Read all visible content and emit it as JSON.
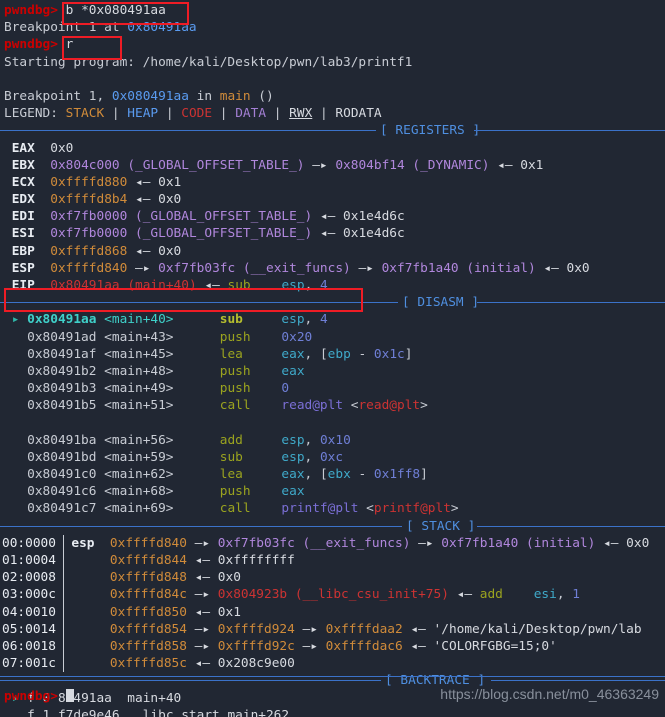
{
  "terminal": {
    "prompt": "pwndbg>",
    "watermark": "https://blog.csdn.net/m0_46363249"
  },
  "session": {
    "cmd1": "b *0x080491aa",
    "out1_a": "Breakpoint 1 at ",
    "out1_b": "0x80491aa",
    "cmd2": "r",
    "out2": "Starting program: /home/kali/Desktop/pwn/lab3/printf1",
    "bp_a": "Breakpoint 1, ",
    "bp_b": "0x080491aa",
    "bp_c": " in ",
    "bp_d": "main",
    "bp_e": " ()",
    "legend_label": "LEGEND: ",
    "legend": {
      "stack": "STACK",
      "heap": "HEAP",
      "code": "CODE",
      "data": "DATA",
      "rwx": "RWX",
      "rodata": "RODATA",
      "sep": " | "
    }
  },
  "sections": {
    "registers": "[ REGISTERS ]",
    "disasm": "[ DISASM ]",
    "stack": "[ STACK ]",
    "backtrace": "[ BACKTRACE ]"
  },
  "registers": [
    {
      "name": "EAX",
      "parts": [
        {
          "t": "0x0",
          "c": "c-num"
        }
      ]
    },
    {
      "name": "EBX",
      "parts": [
        {
          "t": "0x804c000",
          "c": "c-sym"
        },
        {
          "t": " (_GLOBAL_OFFSET_TABLE_)",
          "c": "c-sym"
        },
        {
          "t": " —▸ ",
          "c": "c-arrow"
        },
        {
          "t": "0x804bf14",
          "c": "c-sym"
        },
        {
          "t": " (_DYNAMIC)",
          "c": "c-sym"
        },
        {
          "t": " ◂— ",
          "c": "c-arrow"
        },
        {
          "t": "0x1",
          "c": "c-num"
        }
      ]
    },
    {
      "name": "ECX",
      "parts": [
        {
          "t": "0xffffd880",
          "c": "c-stack"
        },
        {
          "t": " ◂— ",
          "c": "c-arrow"
        },
        {
          "t": "0x1",
          "c": "c-num"
        }
      ]
    },
    {
      "name": "EDX",
      "parts": [
        {
          "t": "0xffffd8b4",
          "c": "c-stack"
        },
        {
          "t": " ◂— ",
          "c": "c-arrow"
        },
        {
          "t": "0x0",
          "c": "c-num"
        }
      ]
    },
    {
      "name": "EDI",
      "parts": [
        {
          "t": "0xf7fb0000",
          "c": "c-sym"
        },
        {
          "t": " (_GLOBAL_OFFSET_TABLE_)",
          "c": "c-sym"
        },
        {
          "t": " ◂— ",
          "c": "c-arrow"
        },
        {
          "t": "0x1e4d6c",
          "c": "c-num"
        }
      ]
    },
    {
      "name": "ESI",
      "parts": [
        {
          "t": "0xf7fb0000",
          "c": "c-sym"
        },
        {
          "t": " (_GLOBAL_OFFSET_TABLE_)",
          "c": "c-sym"
        },
        {
          "t": " ◂— ",
          "c": "c-arrow"
        },
        {
          "t": "0x1e4d6c",
          "c": "c-num"
        }
      ]
    },
    {
      "name": "EBP",
      "parts": [
        {
          "t": "0xffffd868",
          "c": "c-stack"
        },
        {
          "t": " ◂— ",
          "c": "c-arrow"
        },
        {
          "t": "0x0",
          "c": "c-num"
        }
      ]
    },
    {
      "name": "ESP",
      "parts": [
        {
          "t": "0xffffd840",
          "c": "c-stack"
        },
        {
          "t": " —▸ ",
          "c": "c-arrow"
        },
        {
          "t": "0xf7fb03fc",
          "c": "c-sym"
        },
        {
          "t": " (__exit_funcs)",
          "c": "c-sym"
        },
        {
          "t": " —▸ ",
          "c": "c-arrow"
        },
        {
          "t": "0xf7fb1a40",
          "c": "c-sym"
        },
        {
          "t": " (initial)",
          "c": "c-sym"
        },
        {
          "t": " ◂— ",
          "c": "c-arrow"
        },
        {
          "t": "0x0",
          "c": "c-num"
        }
      ]
    },
    {
      "name": "EIP",
      "parts": [
        {
          "t": "0x80491aa",
          "c": "c-eip"
        },
        {
          "t": " (main+40)",
          "c": "c-eip"
        },
        {
          "t": " ◂— ",
          "c": "c-arrow"
        },
        {
          "t": "sub",
          "c": "c-mn"
        },
        {
          "t": "    ",
          "c": "c-plain"
        },
        {
          "t": "esp",
          "c": "c-op"
        },
        {
          "t": ", ",
          "c": "c-plain"
        },
        {
          "t": "4",
          "c": "c-imm"
        }
      ]
    }
  ],
  "disasm": [
    {
      "marker": "▸",
      "current": true,
      "addr": "0x80491aa",
      "sym": "<main+40>",
      "mn": "sub",
      "ops": [
        {
          "t": "esp",
          "c": "c-op"
        },
        {
          "t": ", ",
          "c": "c-plain"
        },
        {
          "t": "4",
          "c": "c-imm"
        }
      ]
    },
    {
      "marker": " ",
      "current": false,
      "addr": "0x80491ad",
      "sym": "<main+43>",
      "mn": "push",
      "ops": [
        {
          "t": "0x20",
          "c": "c-imm"
        }
      ]
    },
    {
      "marker": " ",
      "current": false,
      "addr": "0x80491af",
      "sym": "<main+45>",
      "mn": "lea",
      "ops": [
        {
          "t": "eax",
          "c": "c-op"
        },
        {
          "t": ", [",
          "c": "c-plain"
        },
        {
          "t": "ebp",
          "c": "c-op"
        },
        {
          "t": " - ",
          "c": "c-plain"
        },
        {
          "t": "0x1c",
          "c": "c-imm"
        },
        {
          "t": "]",
          "c": "c-plain"
        }
      ]
    },
    {
      "marker": " ",
      "current": false,
      "addr": "0x80491b2",
      "sym": "<main+48>",
      "mn": "push",
      "ops": [
        {
          "t": "eax",
          "c": "c-op"
        }
      ]
    },
    {
      "marker": " ",
      "current": false,
      "addr": "0x80491b3",
      "sym": "<main+49>",
      "mn": "push",
      "ops": [
        {
          "t": "0",
          "c": "c-imm"
        }
      ]
    },
    {
      "marker": " ",
      "current": false,
      "addr": "0x80491b5",
      "sym": "<main+51>",
      "mn": "call",
      "ops": [
        {
          "t": "read@plt",
          "c": "c-call-t"
        },
        {
          "t": " <",
          "c": "c-plain"
        },
        {
          "t": "read@plt",
          "c": "c-callsym"
        },
        {
          "t": ">",
          "c": "c-plain"
        }
      ]
    },
    {
      "blank": true
    },
    {
      "marker": " ",
      "current": false,
      "addr": "0x80491ba",
      "sym": "<main+56>",
      "mn": "add",
      "ops": [
        {
          "t": "esp",
          "c": "c-op"
        },
        {
          "t": ", ",
          "c": "c-plain"
        },
        {
          "t": "0x10",
          "c": "c-imm"
        }
      ]
    },
    {
      "marker": " ",
      "current": false,
      "addr": "0x80491bd",
      "sym": "<main+59>",
      "mn": "sub",
      "ops": [
        {
          "t": "esp",
          "c": "c-op"
        },
        {
          "t": ", ",
          "c": "c-plain"
        },
        {
          "t": "0xc",
          "c": "c-imm"
        }
      ]
    },
    {
      "marker": " ",
      "current": false,
      "addr": "0x80491c0",
      "sym": "<main+62>",
      "mn": "lea",
      "ops": [
        {
          "t": "eax",
          "c": "c-op"
        },
        {
          "t": ", [",
          "c": "c-plain"
        },
        {
          "t": "ebx",
          "c": "c-op"
        },
        {
          "t": " - ",
          "c": "c-plain"
        },
        {
          "t": "0x1ff8",
          "c": "c-imm"
        },
        {
          "t": "]",
          "c": "c-plain"
        }
      ]
    },
    {
      "marker": " ",
      "current": false,
      "addr": "0x80491c6",
      "sym": "<main+68>",
      "mn": "push",
      "ops": [
        {
          "t": "eax",
          "c": "c-op"
        }
      ]
    },
    {
      "marker": " ",
      "current": false,
      "addr": "0x80491c7",
      "sym": "<main+69>",
      "mn": "call",
      "ops": [
        {
          "t": "printf@plt",
          "c": "c-call-t"
        },
        {
          "t": " <",
          "c": "c-plain"
        },
        {
          "t": "printf@plt",
          "c": "c-callsym"
        },
        {
          "t": ">",
          "c": "c-plain"
        }
      ]
    }
  ],
  "stack": [
    {
      "idx": "00:0000",
      "reg": "esp",
      "parts": [
        {
          "t": "0xffffd840",
          "c": "c-stack"
        },
        {
          "t": " —▸ ",
          "c": "c-arrow"
        },
        {
          "t": "0xf7fb03fc",
          "c": "c-sym"
        },
        {
          "t": " (__exit_funcs)",
          "c": "c-sym"
        },
        {
          "t": " —▸ ",
          "c": "c-arrow"
        },
        {
          "t": "0xf7fb1a40",
          "c": "c-sym"
        },
        {
          "t": " (initial)",
          "c": "c-sym"
        },
        {
          "t": " ◂— ",
          "c": "c-arrow"
        },
        {
          "t": "0x0",
          "c": "c-num"
        }
      ]
    },
    {
      "idx": "01:0004",
      "reg": "",
      "parts": [
        {
          "t": "0xffffd844",
          "c": "c-stack"
        },
        {
          "t": " ◂— ",
          "c": "c-arrow"
        },
        {
          "t": "0xffffffff",
          "c": "c-num"
        }
      ]
    },
    {
      "idx": "02:0008",
      "reg": "",
      "parts": [
        {
          "t": "0xffffd848",
          "c": "c-stack"
        },
        {
          "t": " ◂— ",
          "c": "c-arrow"
        },
        {
          "t": "0x0",
          "c": "c-num"
        }
      ]
    },
    {
      "idx": "03:000c",
      "reg": "",
      "parts": [
        {
          "t": "0xffffd84c",
          "c": "c-stack"
        },
        {
          "t": " —▸ ",
          "c": "c-arrow"
        },
        {
          "t": "0x804923b",
          "c": "c-code"
        },
        {
          "t": " (__libc_csu_init+75)",
          "c": "c-code"
        },
        {
          "t": " ◂— ",
          "c": "c-arrow"
        },
        {
          "t": "add",
          "c": "c-mn"
        },
        {
          "t": "    ",
          "c": "c-plain"
        },
        {
          "t": "esi",
          "c": "c-op"
        },
        {
          "t": ", ",
          "c": "c-plain"
        },
        {
          "t": "1",
          "c": "c-imm"
        }
      ]
    },
    {
      "idx": "04:0010",
      "reg": "",
      "parts": [
        {
          "t": "0xffffd850",
          "c": "c-stack"
        },
        {
          "t": " ◂— ",
          "c": "c-arrow"
        },
        {
          "t": "0x1",
          "c": "c-num"
        }
      ]
    },
    {
      "idx": "05:0014",
      "reg": "",
      "parts": [
        {
          "t": "0xffffd854",
          "c": "c-stack"
        },
        {
          "t": " —▸ ",
          "c": "c-arrow"
        },
        {
          "t": "0xffffd924",
          "c": "c-stack"
        },
        {
          "t": " —▸ ",
          "c": "c-arrow"
        },
        {
          "t": "0xffffdaa2",
          "c": "c-stack"
        },
        {
          "t": " ◂— ",
          "c": "c-arrow"
        },
        {
          "t": "'/home/kali/Desktop/pwn/lab",
          "c": "c-str"
        }
      ]
    },
    {
      "idx": "06:0018",
      "reg": "",
      "parts": [
        {
          "t": "0xffffd858",
          "c": "c-stack"
        },
        {
          "t": " —▸ ",
          "c": "c-arrow"
        },
        {
          "t": "0xffffd92c",
          "c": "c-stack"
        },
        {
          "t": " —▸ ",
          "c": "c-arrow"
        },
        {
          "t": "0xffffdac6",
          "c": "c-stack"
        },
        {
          "t": " ◂— ",
          "c": "c-arrow"
        },
        {
          "t": "'COLORFGBG=15;0'",
          "c": "c-str"
        }
      ]
    },
    {
      "idx": "07:001c",
      "reg": "",
      "parts": [
        {
          "t": "0xffffd85c",
          "c": "c-stack"
        },
        {
          "t": " ◂— ",
          "c": "c-arrow"
        },
        {
          "t": "0x208c9e00",
          "c": "c-num"
        }
      ]
    }
  ],
  "backtrace": [
    {
      "marker": "▸",
      "frame": "f 0",
      "addr": "80491aa",
      "sym": "main+40"
    },
    {
      "marker": " ",
      "frame": "f 1",
      "addr": "f7de9e46",
      "sym": "__libc_start_main+262"
    }
  ],
  "colors": {
    "background": "#212733",
    "highlight_box": "#ee1c25",
    "prompt": "#cc0000",
    "separator": "#3b72c9",
    "stack_color": "#d08b3a",
    "code_color": "#cc3333",
    "data_color": "#a37fd4",
    "heap_color": "#5a9bf0"
  }
}
